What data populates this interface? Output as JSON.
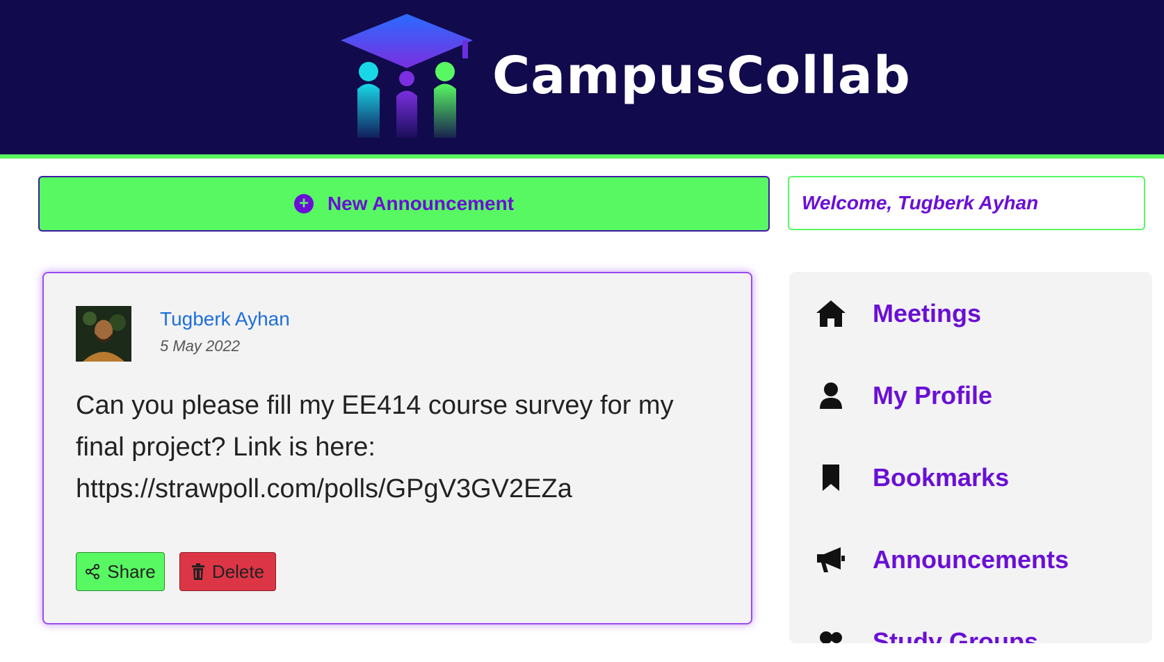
{
  "header": {
    "brand_name": "CampusCollab",
    "logo_icon": "graduation-cap-people-logo"
  },
  "actions": {
    "new_announcement_label": "New Announcement",
    "new_announcement_icon": "plus-circle-icon"
  },
  "welcome": {
    "text": "Welcome, Tugberk Ayhan"
  },
  "post": {
    "author": "Tugberk Ayhan",
    "date": "5 May 2022",
    "body": "Can you please fill my EE414 course survey for my final project? Link is here: https://strawpoll.com/polls/GPgV3GV2EZa",
    "share_label": "Share",
    "delete_label": "Delete"
  },
  "sidebar": {
    "items": [
      {
        "label": "Meetings",
        "icon": "home-icon"
      },
      {
        "label": "My Profile",
        "icon": "user-icon"
      },
      {
        "label": "Bookmarks",
        "icon": "bookmark-icon"
      },
      {
        "label": "Announcements",
        "icon": "megaphone-icon"
      },
      {
        "label": "Study Groups",
        "icon": "users-icon"
      }
    ]
  },
  "colors": {
    "header_bg": "#110a4d",
    "accent_green": "#58f862",
    "accent_purple": "#6a0fd6",
    "danger_red": "#dc3545",
    "author_blue": "#1e6fd9"
  }
}
